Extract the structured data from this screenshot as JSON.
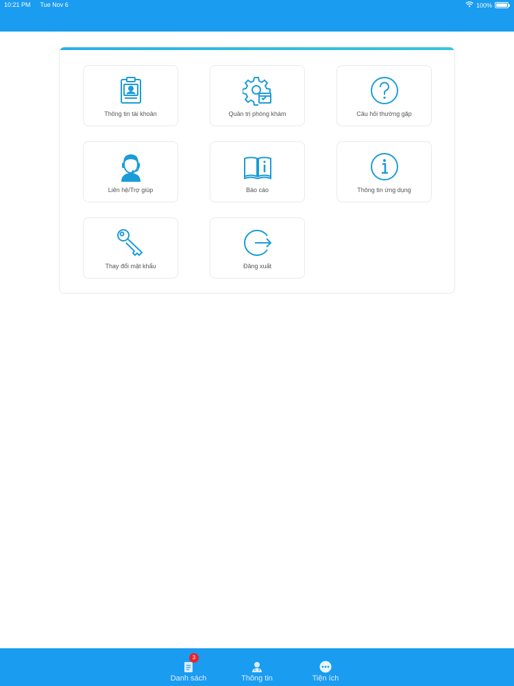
{
  "status_bar": {
    "time": "10:21 PM",
    "date": "Tue Nov 6",
    "battery": "100%",
    "battery_level": 1.0
  },
  "colors": {
    "primary": "#1a9cf0",
    "icon": "#1a9cd8",
    "badge": "#e8242c"
  },
  "menu": {
    "items": [
      {
        "label": "Thông tin tài khoản",
        "icon": "account-card-icon"
      },
      {
        "label": "Quản trị phòng khám",
        "icon": "clinic-settings-icon"
      },
      {
        "label": "Câu hỏi thường gặp",
        "icon": "question-icon"
      },
      {
        "label": "Liên hệ/Trợ giúp",
        "icon": "support-headset-icon"
      },
      {
        "label": "Báo cáo",
        "icon": "report-book-icon"
      },
      {
        "label": "Thông tin ứng dụng",
        "icon": "info-icon"
      },
      {
        "label": "Thay đổi mật khẩu",
        "icon": "key-icon"
      },
      {
        "label": "Đăng xuất",
        "icon": "logout-icon"
      }
    ]
  },
  "tabbar": {
    "tabs": [
      {
        "label": "Danh sách",
        "icon": "list-icon",
        "badge": "3"
      },
      {
        "label": "Thông tin",
        "icon": "doctor-icon"
      },
      {
        "label": "Tiện ích",
        "icon": "more-icon"
      }
    ]
  }
}
